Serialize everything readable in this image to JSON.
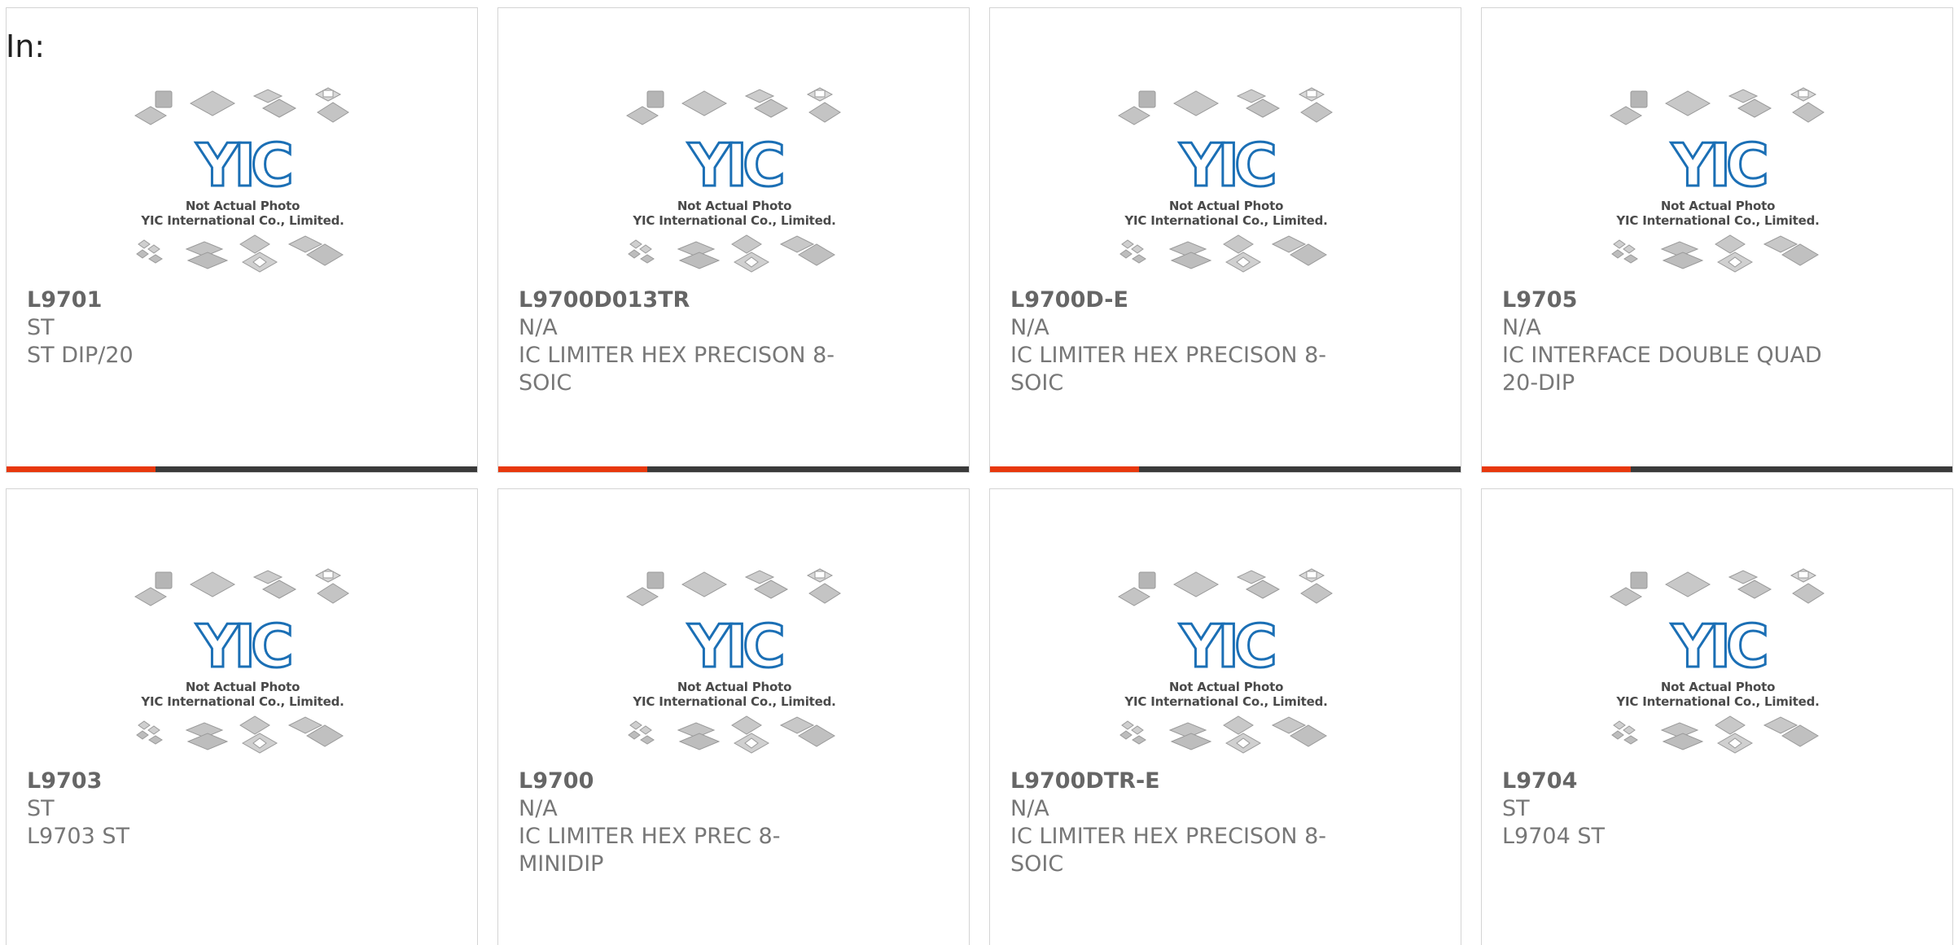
{
  "header": {
    "in_label": "In:"
  },
  "colors": {
    "accent": "#e8380d",
    "bar": "#3a3a3a",
    "logo": "#1b6fb5"
  },
  "placeholder": {
    "logo_text": "YIC",
    "caption_line1": "Not Actual Photo",
    "caption_line2": "YIC International Co., Limited."
  },
  "products": [
    {
      "part": "L9701",
      "maker": "ST",
      "desc": "ST DIP/20"
    },
    {
      "part": "L9700D013TR",
      "maker": "N/A",
      "desc": "IC LIMITER HEX PRECISON 8-SOIC"
    },
    {
      "part": "L9700D-E",
      "maker": "N/A",
      "desc": "IC LIMITER HEX PRECISON 8-SOIC"
    },
    {
      "part": "L9705",
      "maker": "N/A",
      "desc": "IC INTERFACE DOUBLE QUAD 20-DIP"
    },
    {
      "part": "L9703",
      "maker": "ST",
      "desc": "L9703 ST"
    },
    {
      "part": "L9700",
      "maker": "N/A",
      "desc": "IC LIMITER HEX PREC 8-MINIDIP"
    },
    {
      "part": "L9700DTR-E",
      "maker": "N/A",
      "desc": "IC LIMITER HEX PRECISON 8-SOIC"
    },
    {
      "part": "L9704",
      "maker": "ST",
      "desc": "L9704 ST"
    }
  ]
}
